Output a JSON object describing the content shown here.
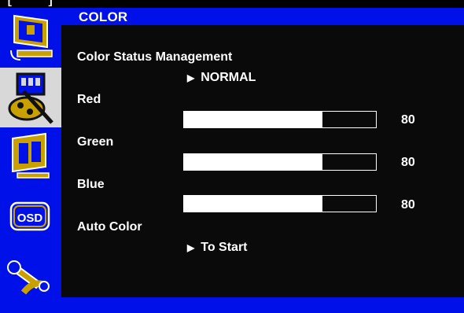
{
  "header": {
    "title": "COLOR",
    "bracket_left": "[",
    "bracket_right": "]"
  },
  "sidebar": {
    "items": [
      {
        "icon": "picture-adjust-icon",
        "selected": false
      },
      {
        "icon": "color-palette-icon",
        "selected": true
      },
      {
        "icon": "display-position-icon",
        "selected": false
      },
      {
        "icon": "osd-icon",
        "label": "OSD",
        "selected": false
      },
      {
        "icon": "tools-wrench-icon",
        "selected": false
      }
    ]
  },
  "menu": {
    "color_status_label": "Color Status Management",
    "color_status_value": "NORMAL",
    "red_label": "Red",
    "red_value": "80",
    "green_label": "Green",
    "green_value": "80",
    "blue_label": "Blue",
    "blue_value": "80",
    "auto_color_label": "Auto Color",
    "auto_color_value": "To Start",
    "arrow": "▶"
  },
  "levels": {
    "red": 0.72,
    "green": 0.72,
    "blue": 0.72
  },
  "colors": {
    "accent_blue": "#0010e8",
    "selected_bg": "#d8d8d8",
    "icon_gold": "#c8a000",
    "text": "#ffffff"
  }
}
